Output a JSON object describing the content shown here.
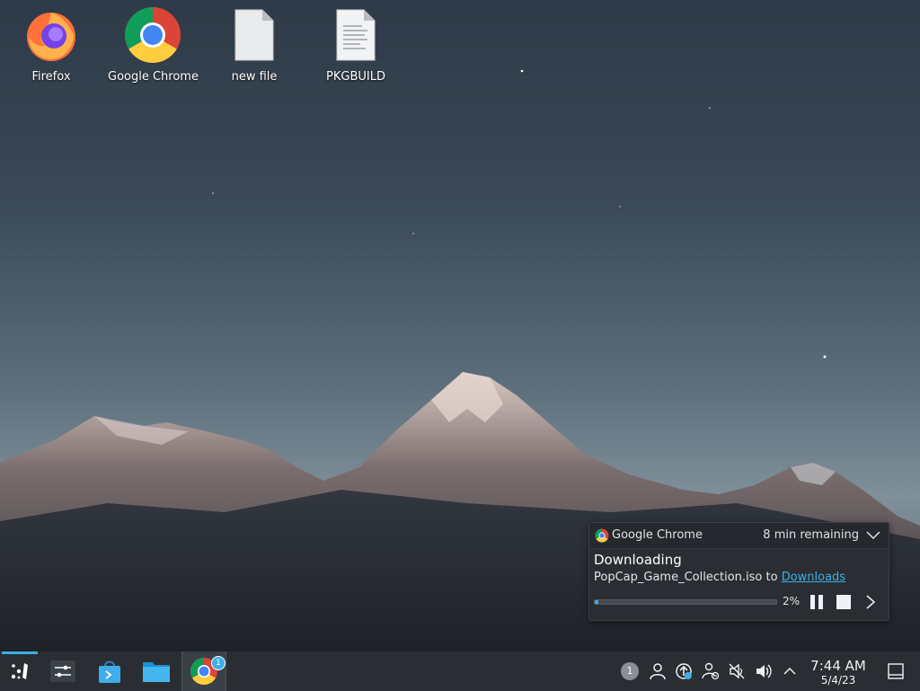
{
  "desktop": {
    "icons": [
      {
        "label": "Firefox",
        "icon": "firefox-icon"
      },
      {
        "label": "Google Chrome",
        "icon": "chrome-icon"
      },
      {
        "label": "new file",
        "icon": "blank-file-icon"
      },
      {
        "label": "PKGBUILD",
        "icon": "text-file-icon"
      }
    ]
  },
  "notification": {
    "app_name": "Google Chrome",
    "remaining": "8 min remaining",
    "title": "Downloading",
    "file_text": "PopCap_Game_Collection.iso to",
    "link_text": "Downloads",
    "progress_percent": 2,
    "progress_label": "2%",
    "controls": [
      "pause-icon",
      "stop-icon",
      "chevron-right-icon"
    ]
  },
  "taskbar": {
    "launchers": [
      "app-launcher-icon",
      "system-settings-icon",
      "discover-store-icon",
      "dolphin-files-icon",
      "chrome-icon"
    ],
    "chrome_badge": "1",
    "tray": {
      "notification_count": "1",
      "icons": [
        "notifications-count-icon",
        "user-icon",
        "updates-icon",
        "network-icon",
        "muted-speaker-icon",
        "volume-icon",
        "expand-tray-icon"
      ]
    },
    "clock": {
      "time": "7:44 AM",
      "date": "5/4/23"
    }
  },
  "colors": {
    "accent": "#3daee9",
    "panel": "#2a2e32"
  }
}
